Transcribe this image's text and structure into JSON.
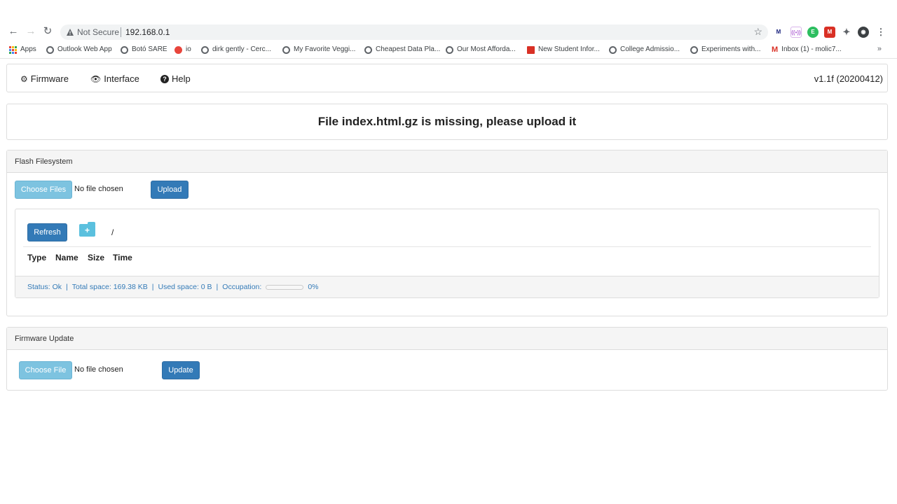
{
  "browser": {
    "security_label": "Not Secure",
    "url": "192.168.0.1",
    "bookmarks": [
      {
        "label": "Apps",
        "icon": "apps-grid-icon"
      },
      {
        "label": "Outlook Web App",
        "icon": "globe-icon"
      },
      {
        "label": "Botó SARE",
        "icon": "globe-icon"
      },
      {
        "label": "io",
        "icon": "alert-circle-icon"
      },
      {
        "label": "dirk gently - Cerc...",
        "icon": "globe-icon"
      },
      {
        "label": "My Favorite Veggi...",
        "icon": "globe-icon"
      },
      {
        "label": "Cheapest Data Pla...",
        "icon": "globe-icon"
      },
      {
        "label": "Our Most Afforda...",
        "icon": "globe-icon"
      },
      {
        "label": "New Student Infor...",
        "icon": "red-square-icon"
      },
      {
        "label": "College Admissio...",
        "icon": "globe-icon"
      },
      {
        "label": "Experiments with...",
        "icon": "globe-icon"
      },
      {
        "label": "Inbox (1) - molic7...",
        "icon": "gmail-icon"
      }
    ],
    "more_label": "»"
  },
  "navbar": {
    "items": [
      {
        "label": "Firmware",
        "icon": "gear-icon"
      },
      {
        "label": "Interface",
        "icon": "eye-icon"
      },
      {
        "label": "Help",
        "icon": "question-circle-icon"
      }
    ],
    "version": "v1.1f (20200412)"
  },
  "message": "File index.html.gz is missing, please upload it",
  "flash": {
    "title": "Flash Filesystem",
    "choose_label": "Choose Files",
    "no_file": "No file chosen",
    "upload_label": "Upload",
    "refresh_label": "Refresh",
    "new_folder_label": "+",
    "path": "/",
    "columns": [
      "Type",
      "Name",
      "Size",
      "Time"
    ],
    "status": {
      "status": "Status: Ok",
      "total": "Total space: 169.38 KB",
      "used": "Used space: 0 B",
      "occupation_label": "Occupation:",
      "occupation_value": "0%",
      "occupation_fraction": 0
    }
  },
  "firmware": {
    "title": "Firmware Update",
    "choose_label": "Choose File",
    "no_file": "No file chosen",
    "update_label": "Update"
  },
  "colors": {
    "primary": "#337ab7",
    "info": "#5bc0de",
    "panel_header": "#f5f5f5"
  }
}
